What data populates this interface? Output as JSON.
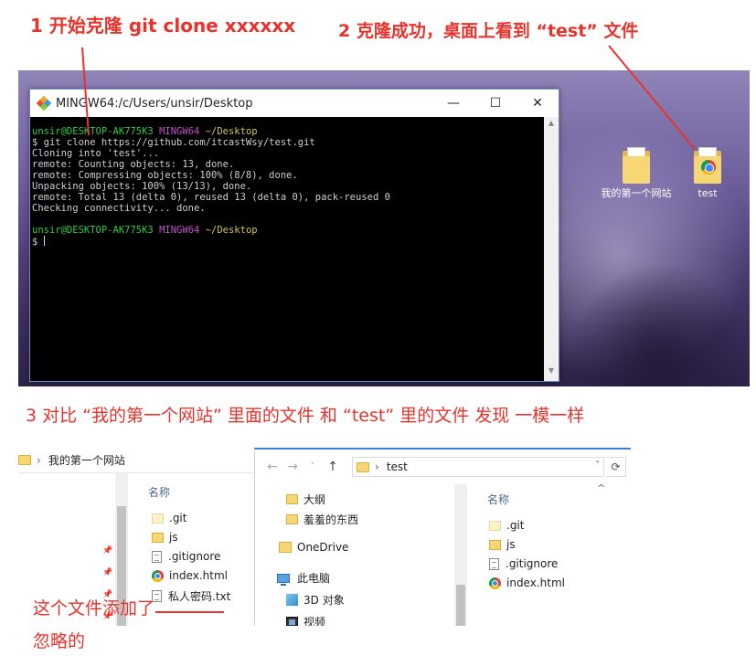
{
  "annotations": {
    "step1": "1 开始克隆 git clone xxxxxx",
    "step2": "2 克隆成功，桌面上看到 “test” 文件",
    "step3": "3 对比 “我的第一个网站” 里面的文件 和 “test” 里的文件 发现 一模一样",
    "note": "这个文件添加了 忽略的"
  },
  "desktop": {
    "icons": [
      {
        "label": "我的第一个网站"
      },
      {
        "label": "test"
      }
    ]
  },
  "terminal": {
    "title": "MINGW64:/c/Users/unsir/Desktop",
    "buttons": {
      "minimize": "—",
      "maximize": "☐",
      "close": "✕"
    },
    "prompt1": {
      "user": "unsir@DESKTOP-AK775K3",
      "env": "MINGW64",
      "path": "~/Desktop"
    },
    "command": "$ git clone https://github.com/itcastWsy/test.git",
    "output": [
      "Cloning into 'test'...",
      "remote: Counting objects: 13, done.",
      "remote: Compressing objects: 100% (8/8), done.",
      "Unpacking objects: 100% (13/13), done.",
      "remote: Total 13 (delta 0), reused 13 (delta 0), pack-reused 0",
      "Checking connectivity... done."
    ],
    "prompt2": {
      "user": "unsir@DESKTOP-AK775K3",
      "env": "MINGW64",
      "path": "~/Desktop"
    },
    "prompt_symbol": "$ "
  },
  "explorer_left": {
    "breadcrumb": "我的第一个网站",
    "column_header": "名称",
    "files": [
      {
        "name": ".git",
        "type": "folder-pale"
      },
      {
        "name": "js",
        "type": "folder"
      },
      {
        "name": ".gitignore",
        "type": "doc"
      },
      {
        "name": "index.html",
        "type": "chrome"
      },
      {
        "name": "私人密码.txt",
        "type": "doc"
      }
    ]
  },
  "explorer_right": {
    "breadcrumb": "test",
    "column_header": "名称",
    "nav": [
      {
        "name": "大纲"
      },
      {
        "name": "羞羞的东西"
      },
      {
        "name": "OneDrive"
      },
      {
        "name": "此电脑"
      },
      {
        "name": "3D 对象"
      },
      {
        "name": "视频"
      }
    ],
    "files": [
      {
        "name": ".git",
        "type": "folder-pale"
      },
      {
        "name": "js",
        "type": "folder"
      },
      {
        "name": ".gitignore",
        "type": "doc"
      },
      {
        "name": "index.html",
        "type": "chrome"
      }
    ]
  },
  "colors": {
    "annotation": "#e8332c",
    "accent": "#3b7fd4"
  }
}
